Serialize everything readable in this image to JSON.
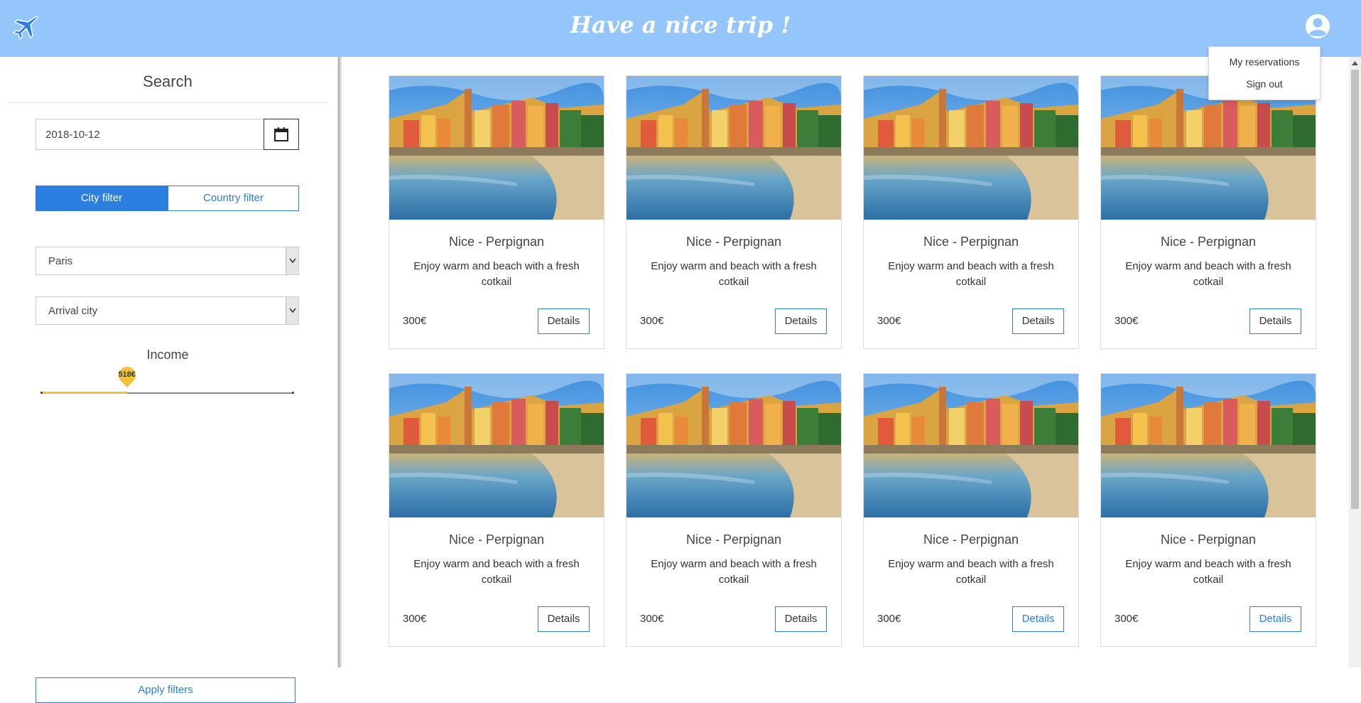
{
  "header": {
    "title": "Have a nice trip !",
    "logo_icon": "airplane-icon",
    "user_icon": "user-avatar-icon",
    "background": "#94c5fb"
  },
  "user_menu": {
    "items": [
      {
        "label": "My reservations"
      },
      {
        "label": "Sign out"
      }
    ]
  },
  "sidebar": {
    "title": "Search",
    "date_value": "2018-10-12",
    "calendar_icon": "calendar-icon",
    "filter_tabs": [
      {
        "label": "City filter",
        "active": true
      },
      {
        "label": "Country filter",
        "active": false
      }
    ],
    "departure_select": {
      "value": "Paris"
    },
    "arrival_select": {
      "value": "Arrival city"
    },
    "income": {
      "label": "Income",
      "value_label": "518€",
      "fraction": 0.34,
      "accent": "#f3c13a"
    },
    "apply_label": "Apply filters"
  },
  "cards": [
    {
      "title": "Nice - Perpignan",
      "description": "Enjoy warm and beach with a fresh cotkail",
      "price": "300€",
      "button": "Details"
    },
    {
      "title": "Nice - Perpignan",
      "description": "Enjoy warm and beach with a fresh cotkail",
      "price": "300€",
      "button": "Details"
    },
    {
      "title": "Nice - Perpignan",
      "description": "Enjoy warm and beach with a fresh cotkail",
      "price": "300€",
      "button": "Details"
    },
    {
      "title": "Nice - Perpignan",
      "description": "Enjoy warm and beach with a fresh cotkail",
      "price": "300€",
      "button": "Details"
    },
    {
      "title": "Nice - Perpignan",
      "description": "Enjoy warm and beach with a fresh cotkail",
      "price": "300€",
      "button": "Details"
    },
    {
      "title": "Nice - Perpignan",
      "description": "Enjoy warm and beach with a fresh cotkail",
      "price": "300€",
      "button": "Details"
    },
    {
      "title": "Nice - Perpignan",
      "description": "Enjoy warm and beach with a fresh cotkail",
      "price": "300€",
      "button": "Details"
    },
    {
      "title": "Nice - Perpignan",
      "description": "Enjoy warm and beach with a fresh cotkail",
      "price": "300€",
      "button": "Details"
    }
  ],
  "colors": {
    "primary": "#2b7fe0",
    "accent": "#f3c13a"
  }
}
